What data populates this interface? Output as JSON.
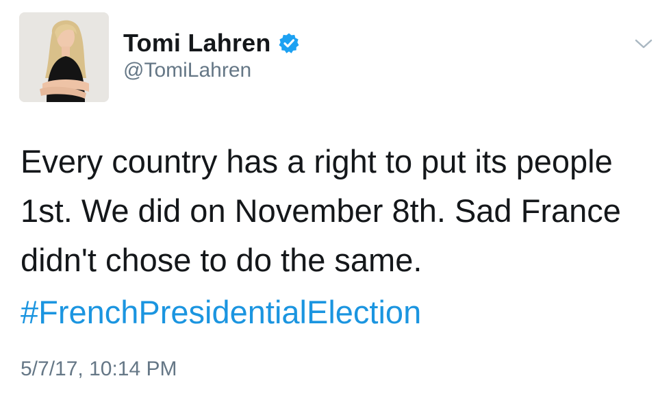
{
  "author": {
    "display_name": "Tomi Lahren",
    "handle": "@TomiLahren",
    "verified": true,
    "verified_icon": "verified-badge-icon",
    "avatar_icon": "profile-photo"
  },
  "menu": {
    "icon": "chevron-down-icon"
  },
  "tweet": {
    "text_lines": [
      "Every country has a right to put its people",
      "1st. We did on November 8th. Sad France",
      "didn't chose to do the same."
    ],
    "hashtag": "#FrenchPresidentialElection",
    "timestamp": "5/7/17, 10:14 PM"
  },
  "colors": {
    "link": "#1b95e0",
    "verified": "#1da1f2",
    "secondary_text": "#657786",
    "primary_text": "#14171a"
  }
}
